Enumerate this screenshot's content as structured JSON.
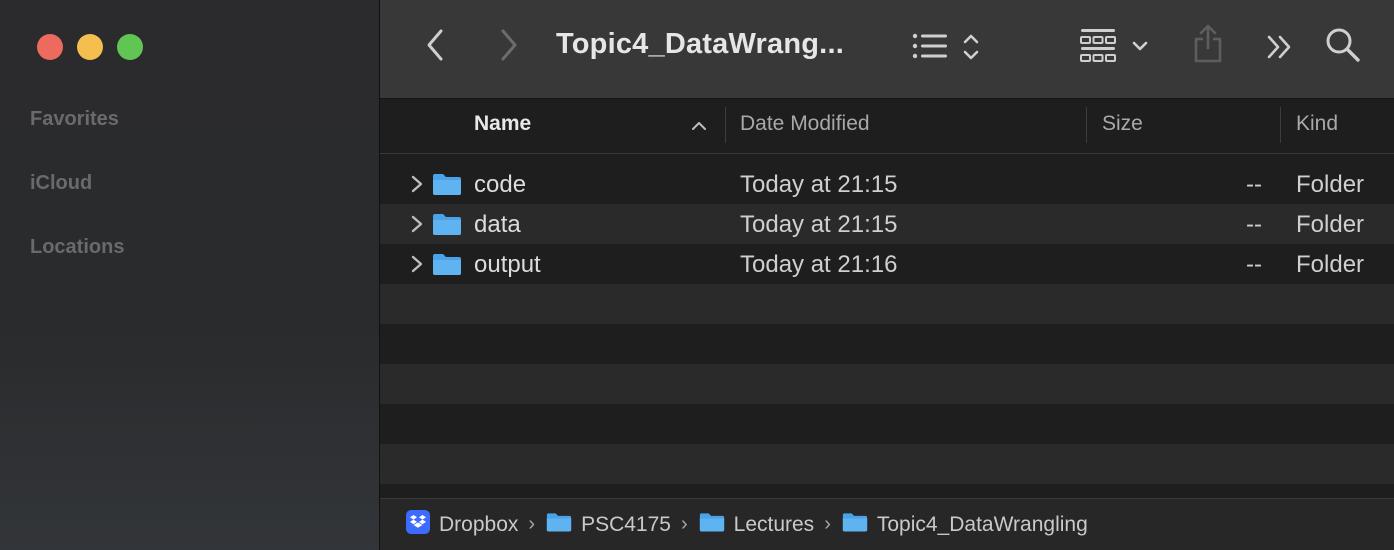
{
  "window": {
    "title": "Topic4_DataWrang..."
  },
  "sidebar": {
    "sections": [
      "Favorites",
      "iCloud",
      "Locations"
    ]
  },
  "toolbar": {
    "icons": [
      "back-chevron-icon",
      "forward-chevron-icon",
      "list-view-icon",
      "sort-updown-icon",
      "icon-grid-group-icon",
      "chevron-down-icon",
      "share-icon",
      "more-chevrons-icon",
      "search-icon"
    ]
  },
  "columns": {
    "name": "Name",
    "date_modified": "Date Modified",
    "size": "Size",
    "kind": "Kind",
    "sorted_by": "name",
    "sort_direction": "ascending"
  },
  "files": [
    {
      "name": "code",
      "date": "Today at 21:15",
      "size": "--",
      "kind": "Folder"
    },
    {
      "name": "data",
      "date": "Today at 21:15",
      "size": "--",
      "kind": "Folder"
    },
    {
      "name": "output",
      "date": "Today at 21:16",
      "size": "--",
      "kind": "Folder"
    }
  ],
  "pathbar": {
    "crumbs": [
      "Dropbox",
      "PSC4175",
      "Lectures",
      "Topic4_DataWrangling"
    ]
  },
  "colors": {
    "folder_blue": "#5fb3f0",
    "dropbox_blue": "#3d6bff",
    "close": "#ed6a5e",
    "minimize": "#f5bf4f",
    "zoom": "#61c554"
  }
}
